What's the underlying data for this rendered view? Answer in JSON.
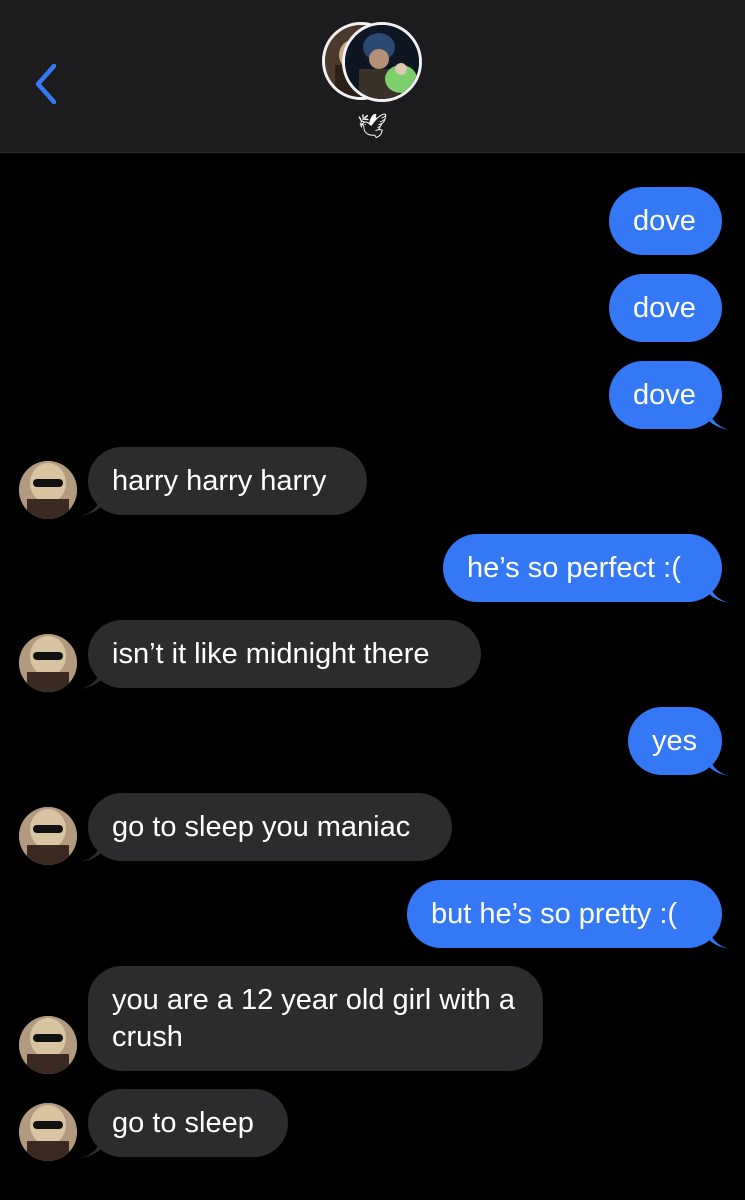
{
  "header": {
    "back_icon": "chevron-left-icon",
    "group_name": "🕊",
    "accent": "#3478f6"
  },
  "messages": [
    {
      "from": "me",
      "text": "dove"
    },
    {
      "from": "me",
      "text": "dove"
    },
    {
      "from": "me",
      "text": "dove"
    },
    {
      "from": "them",
      "text": "harry harry harry"
    },
    {
      "from": "me",
      "text": "he’s so perfect :("
    },
    {
      "from": "them",
      "text": "isn’t it like midnight there"
    },
    {
      "from": "me",
      "text": "yes"
    },
    {
      "from": "them",
      "text": "go to sleep you maniac"
    },
    {
      "from": "me",
      "text": "but he’s so pretty :("
    },
    {
      "from": "them",
      "text": "you are a 12 year old girl with a crush"
    },
    {
      "from": "them",
      "text": "go to sleep"
    }
  ],
  "colors": {
    "sent_bubble": "#3478f6",
    "received_bubble": "#2c2c2e",
    "background": "#000000"
  }
}
